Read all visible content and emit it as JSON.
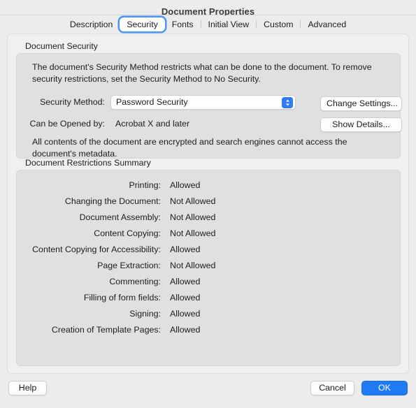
{
  "window": {
    "title": "Document Properties"
  },
  "tabs": [
    {
      "label": "Description",
      "selected": false
    },
    {
      "label": "Security",
      "selected": true
    },
    {
      "label": "Fonts",
      "selected": false
    },
    {
      "label": "Initial View",
      "selected": false
    },
    {
      "label": "Custom",
      "selected": false
    },
    {
      "label": "Advanced",
      "selected": false
    }
  ],
  "document_security": {
    "group_title": "Document Security",
    "description": "The document's Security Method restricts what can be done to the document. To remove security restrictions, set the Security Method to No Security.",
    "security_method_label": "Security Method:",
    "security_method_value": "Password Security",
    "can_be_opened_label": "Can be Opened by:",
    "can_be_opened_value": "Acrobat X and later",
    "change_settings_button": "Change Settings...",
    "show_details_button": "Show Details...",
    "encryption_note": "All contents of the document are encrypted and search engines cannot access the document's metadata."
  },
  "restrictions": {
    "group_title": "Document Restrictions Summary",
    "rows": [
      {
        "label": "Printing:",
        "value": "Allowed"
      },
      {
        "label": "Changing the Document:",
        "value": "Not Allowed"
      },
      {
        "label": "Document Assembly:",
        "value": "Not Allowed"
      },
      {
        "label": "Content Copying:",
        "value": "Not Allowed"
      },
      {
        "label": "Content Copying for Accessibility:",
        "value": "Allowed"
      },
      {
        "label": "Page Extraction:",
        "value": "Not Allowed"
      },
      {
        "label": "Commenting:",
        "value": "Allowed"
      },
      {
        "label": "Filling of form fields:",
        "value": "Allowed"
      },
      {
        "label": "Signing:",
        "value": "Allowed"
      },
      {
        "label": "Creation of Template Pages:",
        "value": "Allowed"
      }
    ]
  },
  "footer": {
    "help_button": "Help",
    "cancel_button": "Cancel",
    "ok_button": "OK"
  },
  "colors": {
    "accent": "#1f7bf5",
    "focus_ring": "#4a94f8",
    "window_bg": "#ececec",
    "panel_bg": "#f0f0f0",
    "groupbox_bg": "#e0e0e0"
  }
}
